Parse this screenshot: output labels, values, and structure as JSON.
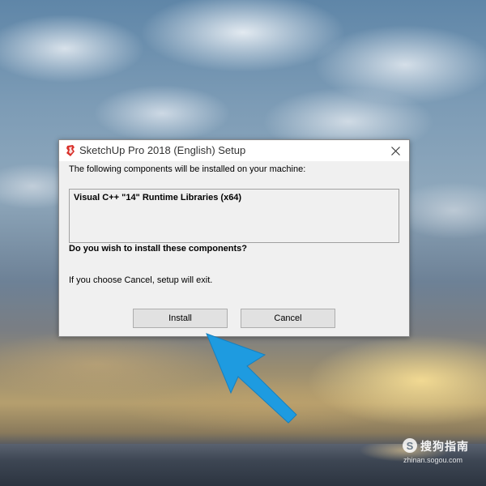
{
  "dialog": {
    "title": "SketchUp Pro 2018 (English) Setup",
    "app_icon": "sketchup-icon",
    "close_icon": "close-icon",
    "message": "The following components will be installed on your machine:",
    "components": [
      "Visual C++ \"14\" Runtime Libraries (x64)"
    ],
    "question": "Do you wish to install these components?",
    "hint": "If you choose Cancel, setup will exit.",
    "install_label": "Install",
    "cancel_label": "Cancel"
  },
  "watermark": {
    "brand": "搜狗指南",
    "url": "zhinan.sogou.com"
  },
  "colors": {
    "arrow": "#1e9be0",
    "app_icon": "#d9312b",
    "dialog_bg": "#f0f0f0"
  }
}
